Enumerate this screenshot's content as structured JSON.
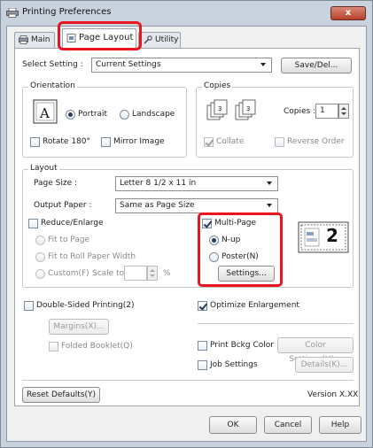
{
  "window": {
    "title": "Printing Preferences",
    "close_label": "x"
  },
  "tabs": [
    {
      "label": "Main"
    },
    {
      "label": "Page Layout"
    },
    {
      "label": "Utility"
    }
  ],
  "select_setting": {
    "label": "Select Setting :",
    "value": "Current Settings",
    "save_button": "Save/Del..."
  },
  "orientation": {
    "title": "Orientation",
    "portrait": "Portrait",
    "landscape": "Landscape",
    "rotate": "Rotate 180°",
    "mirror": "Mirror Image",
    "selected": "Portrait"
  },
  "copies": {
    "title": "Copies",
    "label": "Copies :",
    "value": "1",
    "collate": "Collate",
    "reverse": "Reverse Order"
  },
  "layout": {
    "title": "Layout",
    "page_size_label": "Page Size :",
    "page_size_value": "Letter 8 1/2 x 11 in",
    "output_paper_label": "Output Paper :",
    "output_paper_value": "Same as Page Size",
    "reduce": "Reduce/Enlarge",
    "fit_page": "Fit to Page",
    "fit_roll": "Fit to Roll Paper Width",
    "custom": "Custom(F)",
    "scale_to": "Scale to",
    "scale_unit": "%",
    "multi_page": "Multi-Page",
    "nup": "N-up",
    "poster": "Poster(N)",
    "settings_button": "Settings...",
    "preview_number": "2"
  },
  "double_sided": {
    "label": "Double-Sided Printing(2)",
    "margins_button": "Margins(X)...",
    "folded": "Folded Booklet(Q)"
  },
  "optimize": {
    "label": "Optimize Enlargement"
  },
  "print_bkg": {
    "label": "Print Bckg Color",
    "button": "Color Settings(H)..."
  },
  "job": {
    "label": "Job Settings",
    "button": "Details(K)..."
  },
  "footer": {
    "reset": "Reset Defaults(Y)",
    "version": "Version X.XX",
    "ok": "OK",
    "cancel": "Cancel",
    "help": "Help"
  },
  "colors": {
    "highlight": "#e8141e",
    "title_bar": "#c9d3de"
  }
}
